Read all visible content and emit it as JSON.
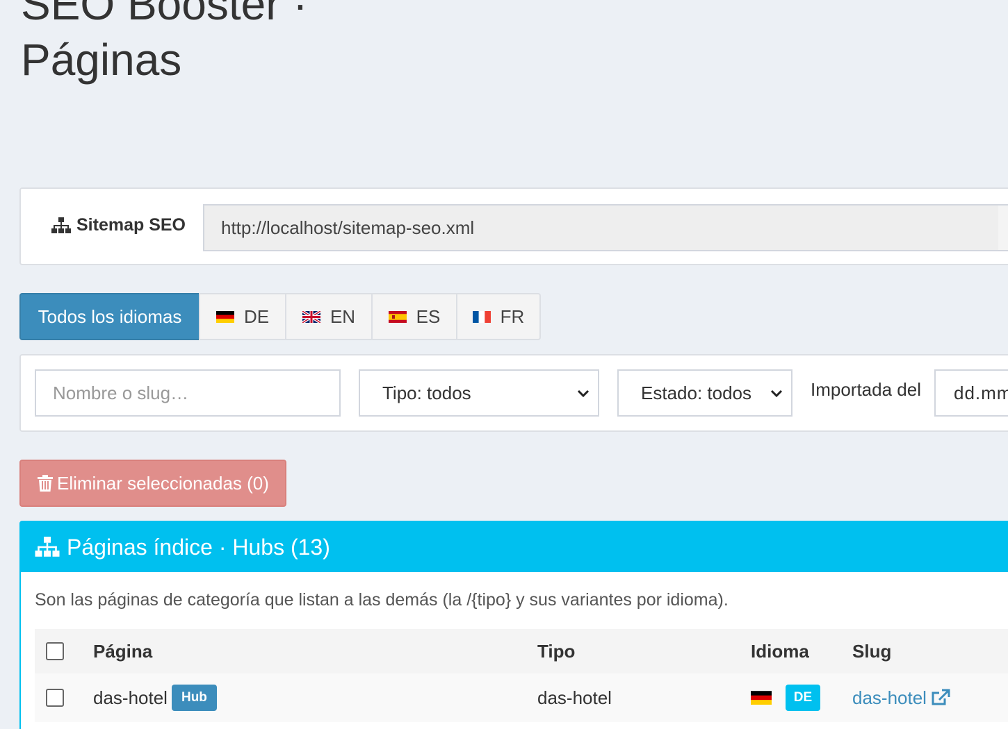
{
  "page": {
    "title_line1": "SEO Booster ·",
    "title_line2": "Páginas"
  },
  "sitemap": {
    "label": "Sitemap SEO",
    "url": "http://localhost/sitemap-seo.xml"
  },
  "language_tabs": [
    {
      "label": "Todos los idiomas",
      "flag": null,
      "active": true
    },
    {
      "label": "DE",
      "flag": "germany-flag-icon",
      "active": false
    },
    {
      "label": "EN",
      "flag": "uk-flag-icon",
      "active": false
    },
    {
      "label": "ES",
      "flag": "spain-flag-icon",
      "active": false
    },
    {
      "label": "FR",
      "flag": "france-flag-icon",
      "active": false
    }
  ],
  "filters": {
    "search_placeholder": "Nombre o slug…",
    "type_select": "Tipo: todos",
    "status_select": "Estado: todos",
    "imported_label": "Importada del",
    "date_placeholder": "dd.mm"
  },
  "actions": {
    "delete_selected": "Eliminar seleccionadas (0)"
  },
  "hubs": {
    "title": "Páginas índice · Hubs (13)",
    "description": "Son las páginas de categoría que listan a las demás (la /{tipo} y sus variantes por idioma).",
    "columns": [
      "Página",
      "Tipo",
      "Idioma",
      "Slug"
    ],
    "rows": [
      {
        "page": "das-hotel",
        "badge": "Hub",
        "type": "das-hotel",
        "lang": "DE",
        "slug": "das-hotel"
      }
    ]
  },
  "colors": {
    "primary": "#3c8dbc",
    "info": "#00c0ef",
    "danger_disabled": "#e08e8b",
    "background": "#ecf0f5"
  }
}
